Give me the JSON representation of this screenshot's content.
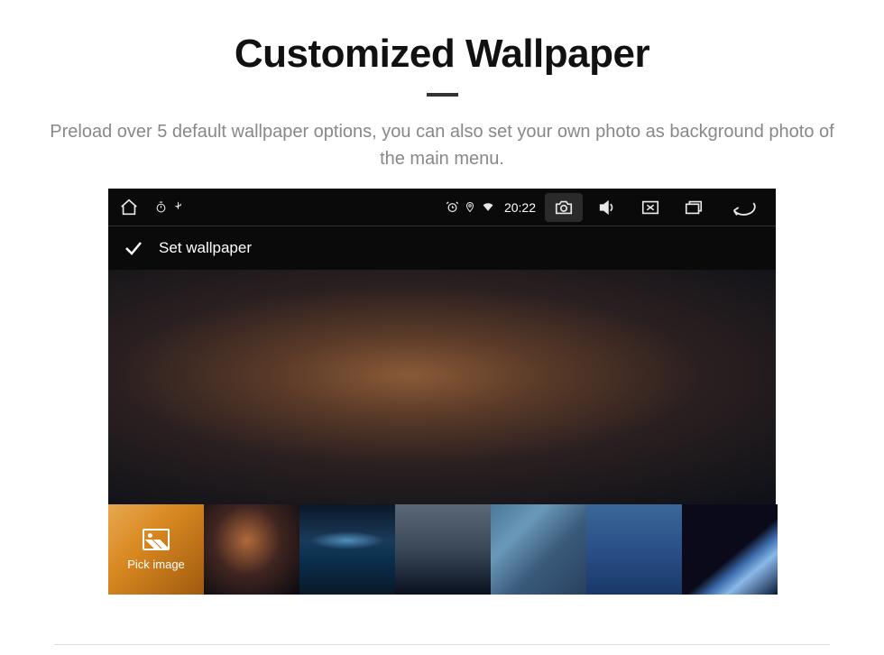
{
  "heading": "Customized Wallpaper",
  "subheading": "Preload over 5 default wallpaper options, you can also set your own photo as background photo of the main menu.",
  "status": {
    "time": "20:22"
  },
  "action": {
    "title": "Set wallpaper"
  },
  "thumbs": {
    "pick_label": "Pick image"
  }
}
